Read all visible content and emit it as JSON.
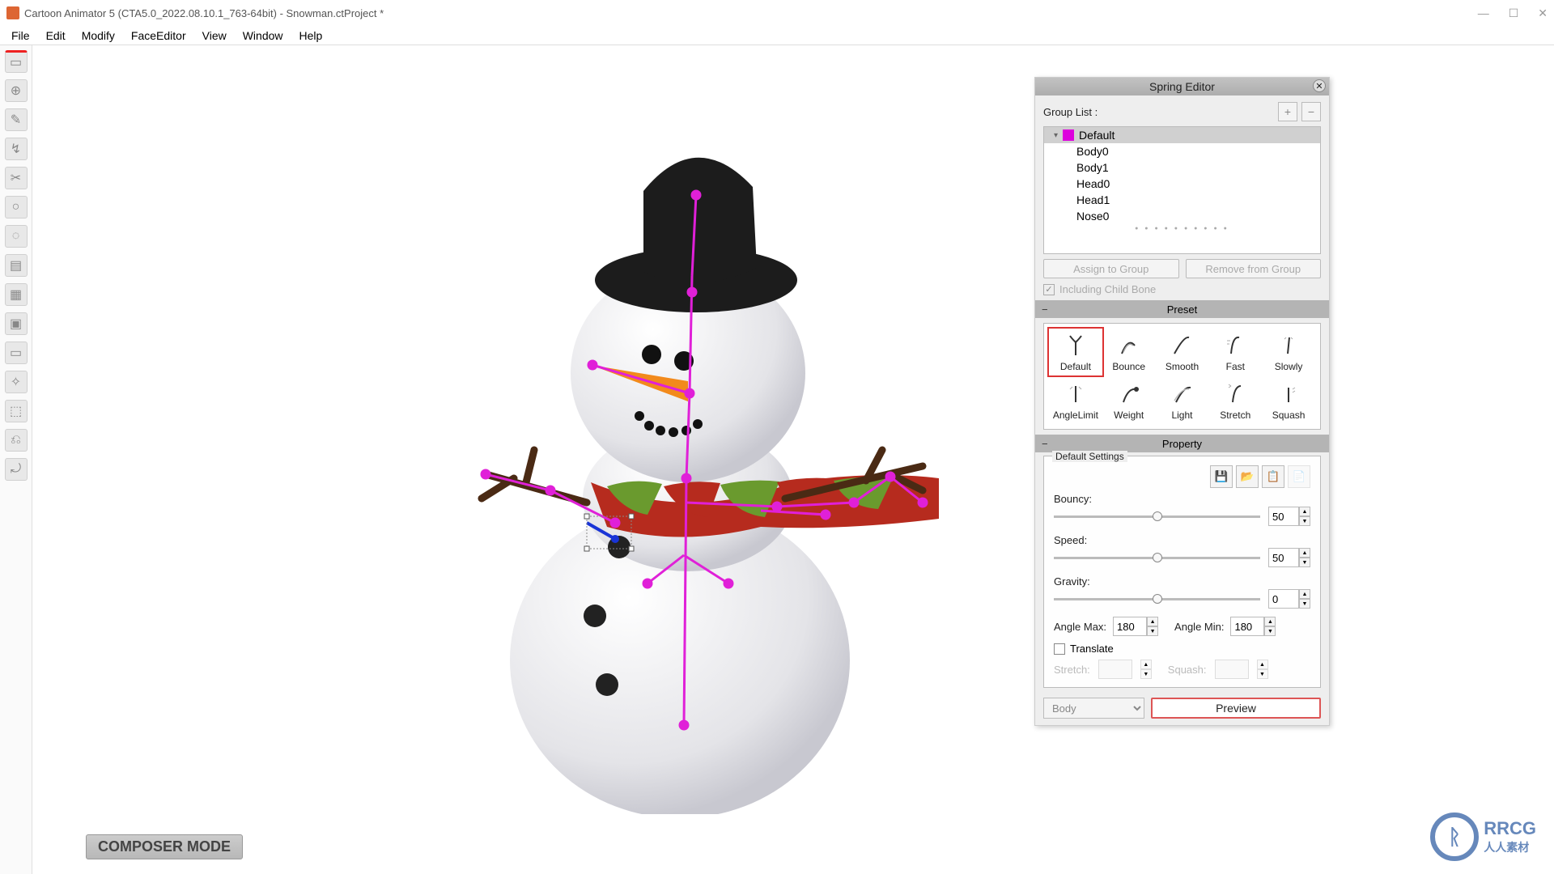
{
  "titlebar": {
    "title": "Cartoon Animator 5 (CTA5.0_2022.08.10.1_763-64bit) - Snowman.ctProject *"
  },
  "menu": {
    "items": [
      "File",
      "Edit",
      "Modify",
      "FaceEditor",
      "View",
      "Window",
      "Help"
    ]
  },
  "composer_badge": "COMPOSER MODE",
  "watermark": {
    "brand": "RRCG",
    "sub": "人人素材"
  },
  "spring_editor": {
    "title": "Spring Editor",
    "group_list_label": "Group List :",
    "add_tooltip": "+",
    "remove_tooltip": "−",
    "group_header": "Default",
    "items": [
      "Body0",
      "Body1",
      "Head0",
      "Head1",
      "Nose0"
    ],
    "assign_btn": "Assign to Group",
    "remove_btn": "Remove from Group",
    "include_child": "Including Child Bone",
    "preset_head": "Preset",
    "presets": [
      {
        "label": "Default"
      },
      {
        "label": "Bounce"
      },
      {
        "label": "Smooth"
      },
      {
        "label": "Fast"
      },
      {
        "label": "Slowly"
      },
      {
        "label": "AngleLimit"
      },
      {
        "label": "Weight"
      },
      {
        "label": "Light"
      },
      {
        "label": "Stretch"
      },
      {
        "label": "Squash"
      }
    ],
    "property_head": "Property",
    "property_legend": "Default Settings",
    "bouncy_label": "Bouncy:",
    "bouncy_value": "50",
    "speed_label": "Speed:",
    "speed_value": "50",
    "gravity_label": "Gravity:",
    "gravity_value": "0",
    "angle_max_label": "Angle Max:",
    "angle_max_value": "180",
    "angle_min_label": "Angle Min:",
    "angle_min_value": "180",
    "translate_label": "Translate",
    "stretch_label": "Stretch:",
    "squash_label": "Squash:",
    "body_select": "Body",
    "preview_btn": "Preview"
  }
}
